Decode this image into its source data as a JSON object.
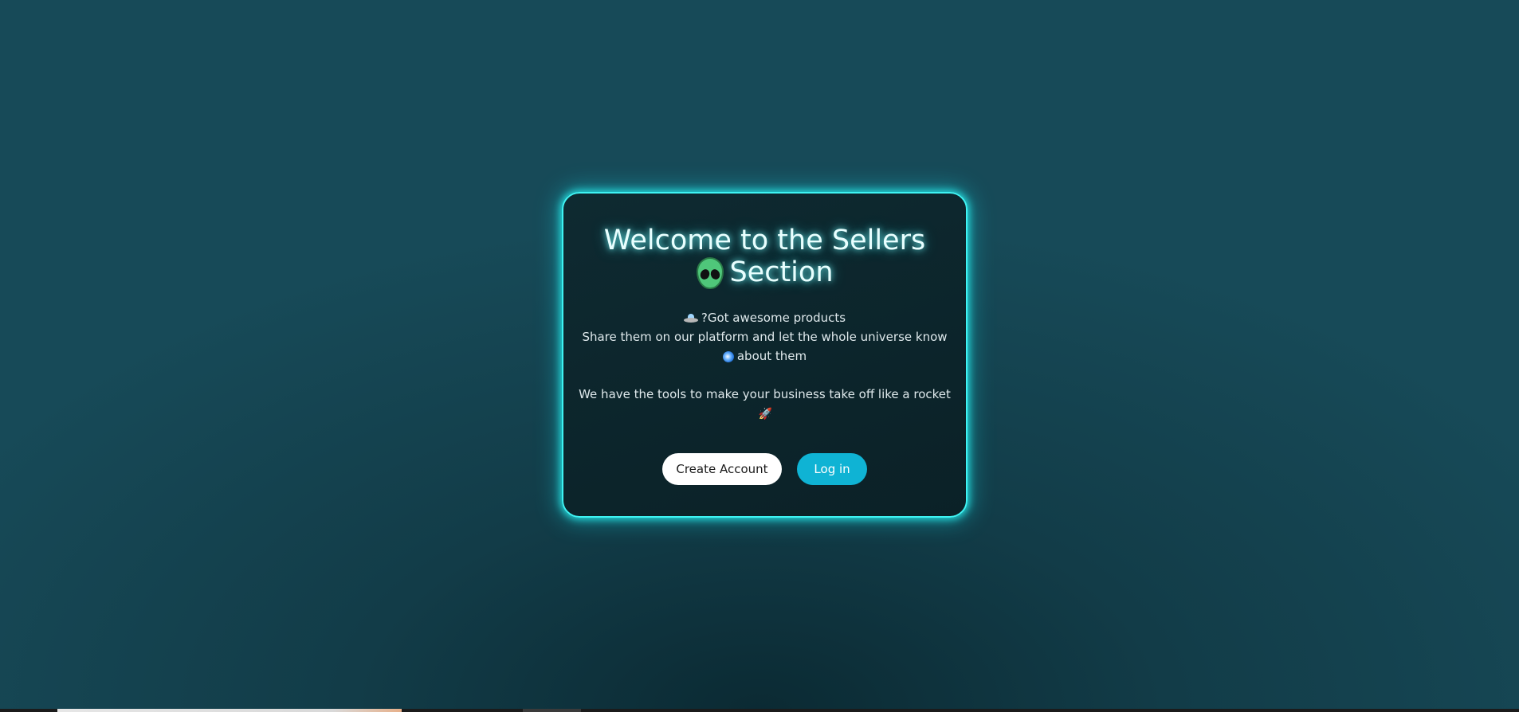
{
  "card": {
    "title_line1": "Welcome to the Sellers",
    "title_line2": "Section",
    "line1": "?Got awesome products",
    "line2": "Share them on our platform and let the whole universe know",
    "line3": "about them",
    "line4": "We have the tools to make your business take off like a rocket"
  },
  "buttons": {
    "create_account": "Create Account",
    "login": "Log in"
  },
  "icons": {
    "alien": "alien-icon",
    "ufo": "ufo-icon",
    "galaxy": "galaxy-icon",
    "rocket": "rocket-icon"
  },
  "colors": {
    "card_glow": "#3ff3f3",
    "login_button": "#0fb3d4",
    "create_button": "#ffffff"
  }
}
